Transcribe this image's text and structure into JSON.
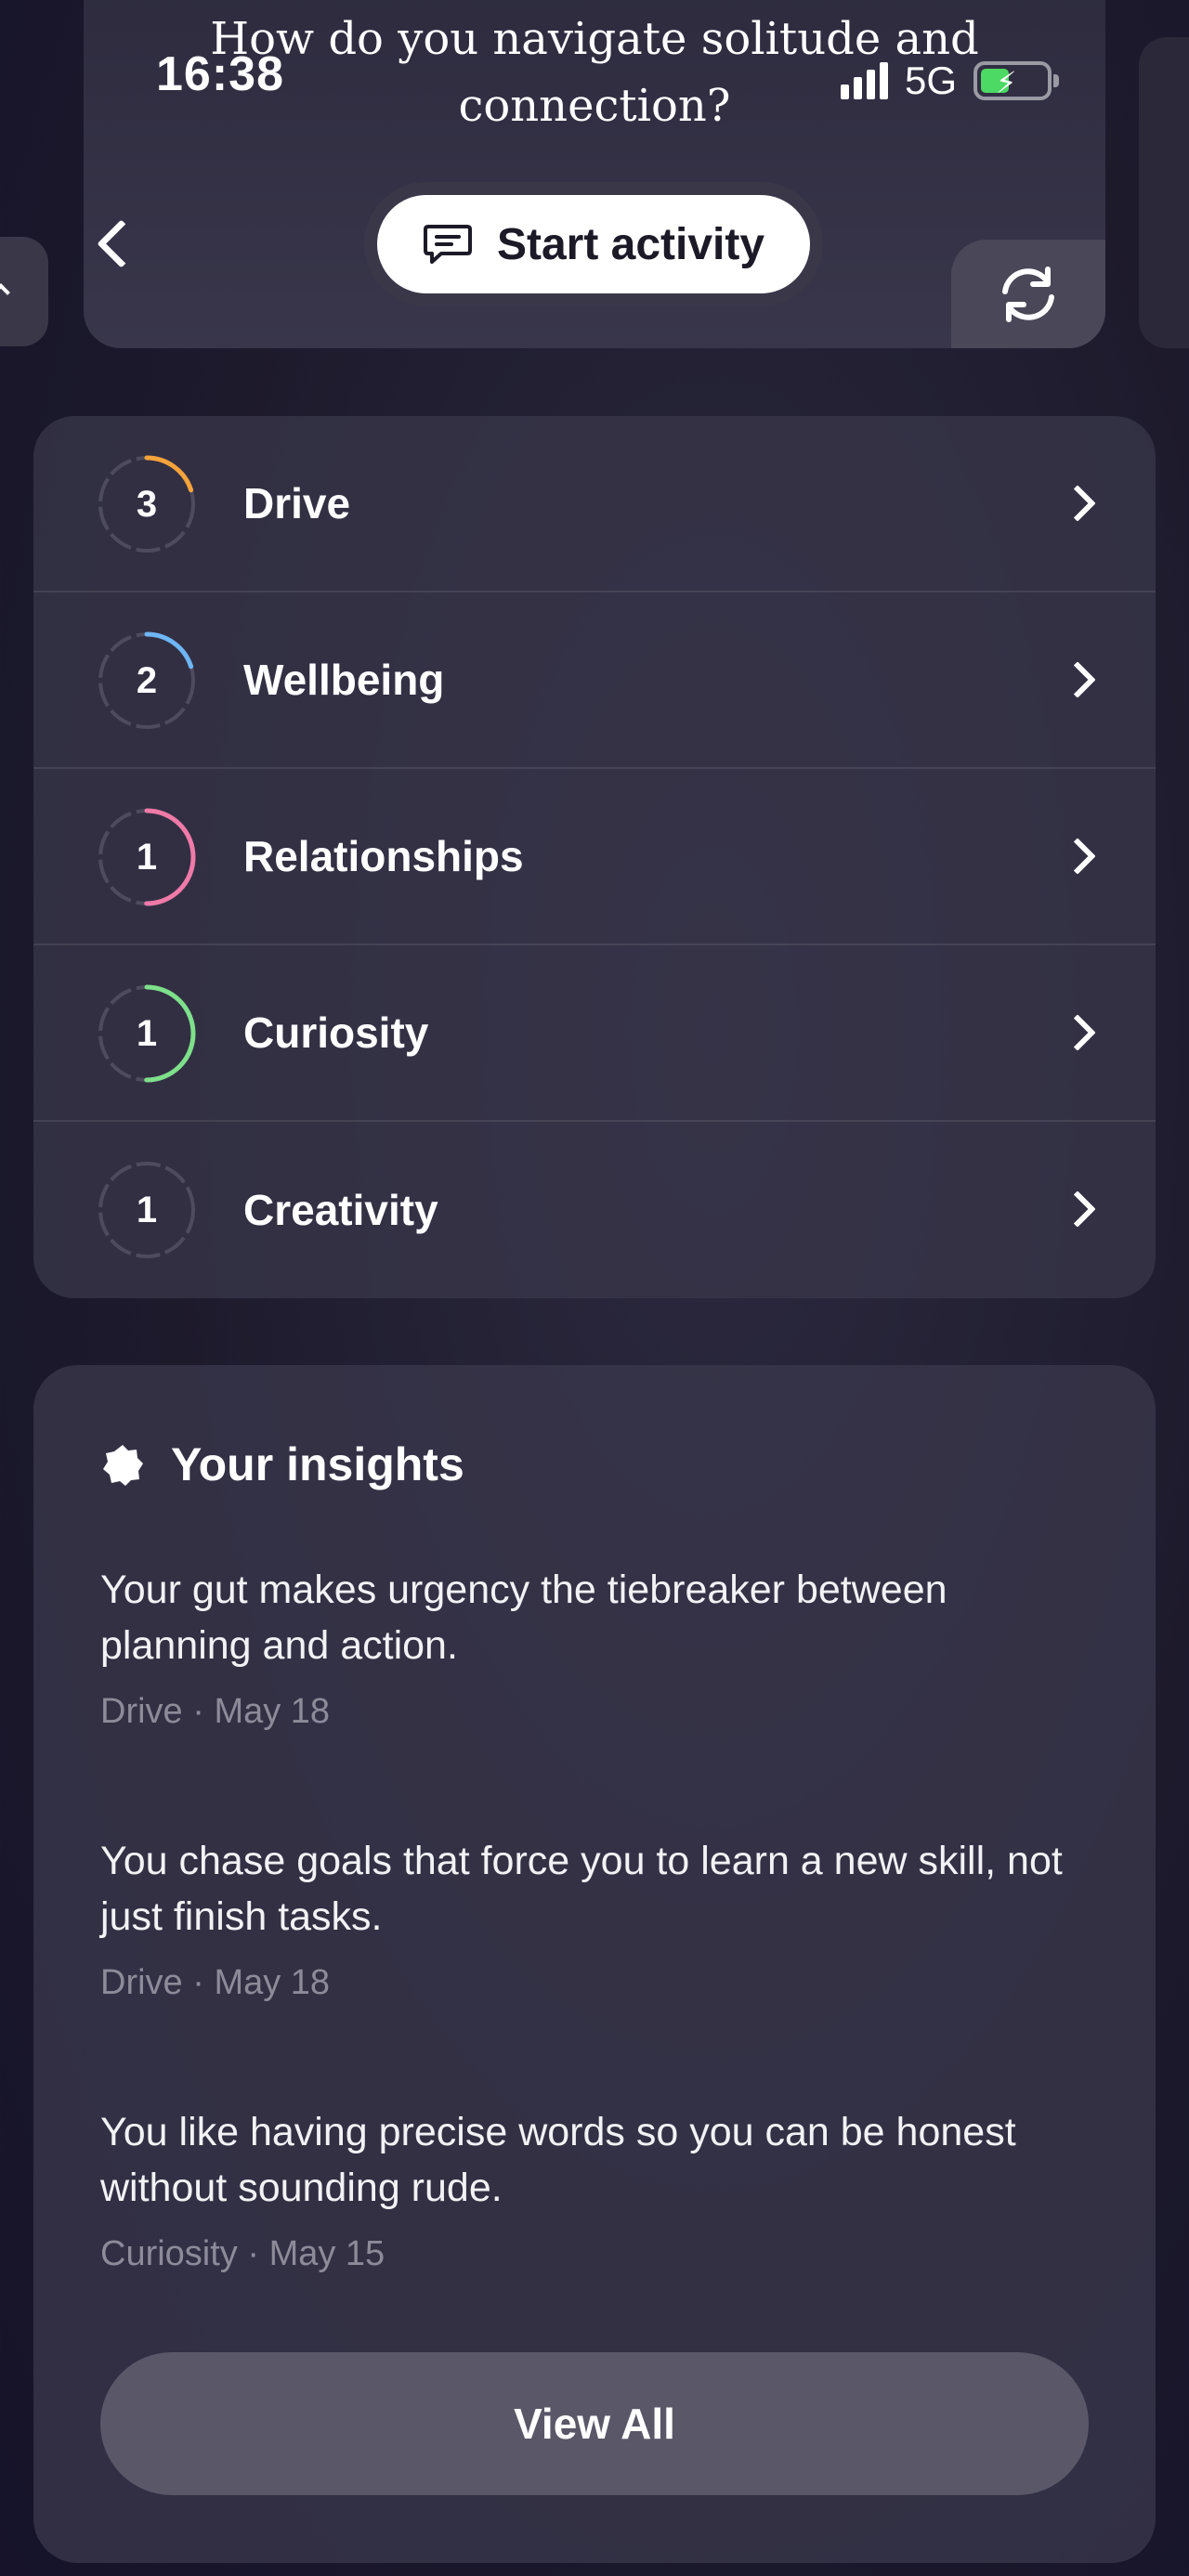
{
  "status_bar": {
    "time": "16:38",
    "network": "5G"
  },
  "header": {
    "question": "How do you navigate solitude and connection?",
    "start_activity_label": "Start activity"
  },
  "categories": [
    {
      "count": "3",
      "label": "Drive",
      "color": "#f5a33b",
      "progress": 0.2
    },
    {
      "count": "2",
      "label": "Wellbeing",
      "color": "#6fb6f5",
      "progress": 0.2
    },
    {
      "count": "1",
      "label": "Relationships",
      "color": "#f07aa8",
      "progress": 0.5
    },
    {
      "count": "1",
      "label": "Curiosity",
      "color": "#7ee08a",
      "progress": 0.5
    },
    {
      "count": "1",
      "label": "Creativity",
      "color": "#55526a",
      "progress": 0.0
    }
  ],
  "insights": {
    "title": "Your insights",
    "items": [
      {
        "text": "Your gut makes urgency the tiebreaker between planning and action.",
        "meta": "Drive · May 18"
      },
      {
        "text": "You chase goals that force you to learn a new skill, not just finish tasks.",
        "meta": "Drive · May 18"
      },
      {
        "text": "You like having precise words so you can be honest without sounding rude.",
        "meta": "Curiosity · May 15"
      }
    ],
    "view_all_label": "View All"
  }
}
